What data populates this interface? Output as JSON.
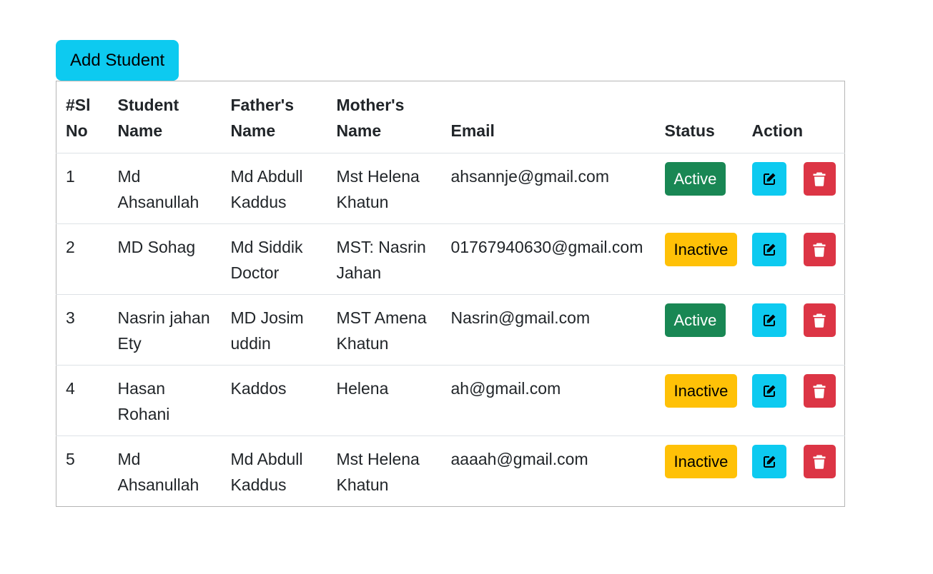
{
  "toolbar": {
    "add_label": "Add Student"
  },
  "table": {
    "headers": {
      "sl": [
        "#Sl",
        "No"
      ],
      "name": [
        "Student",
        "Name"
      ],
      "father": [
        "Father's",
        "Name"
      ],
      "mother": [
        "Mother's",
        "Name"
      ],
      "email": "Email",
      "status": "Status",
      "action": "Action"
    },
    "rows": [
      {
        "sl": "1",
        "name": [
          "Md",
          "Ahsanullah"
        ],
        "father": [
          "Md Abdull",
          "Kaddus"
        ],
        "mother": [
          "Mst Helena",
          "Khatun"
        ],
        "email": "ahsannje@gmail.com",
        "status": "Active"
      },
      {
        "sl": "2",
        "name": [
          "MD Sohag",
          ""
        ],
        "father": [
          "Md Siddik",
          "Doctor"
        ],
        "mother": [
          "MST: Nasrin",
          "Jahan"
        ],
        "email": "01767940630@gmail.com",
        "status": "Inactive"
      },
      {
        "sl": "3",
        "name": [
          "Nasrin jahan",
          "Ety"
        ],
        "father": [
          "MD Josim",
          "uddin"
        ],
        "mother": [
          "MST Amena",
          "Khatun"
        ],
        "email": "Nasrin@gmail.com",
        "status": "Active"
      },
      {
        "sl": "4",
        "name": [
          "Hasan",
          "Rohani"
        ],
        "father": [
          "Kaddos",
          ""
        ],
        "mother": [
          "Helena",
          ""
        ],
        "email": "ah@gmail.com",
        "status": "Inactive"
      },
      {
        "sl": "5",
        "name": [
          "Md",
          "Ahsanullah"
        ],
        "father": [
          "Md Abdull",
          "Kaddus"
        ],
        "mother": [
          "Mst Helena",
          "Khatun"
        ],
        "email": "aaaah@gmail.com",
        "status": "Inactive"
      }
    ]
  },
  "icons": {
    "edit": "edit-icon",
    "delete": "trash-icon"
  },
  "colors": {
    "add_button": "#0dcaf0",
    "active": "#198754",
    "inactive": "#ffc107",
    "edit": "#0dcaf0",
    "delete": "#dc3545"
  }
}
